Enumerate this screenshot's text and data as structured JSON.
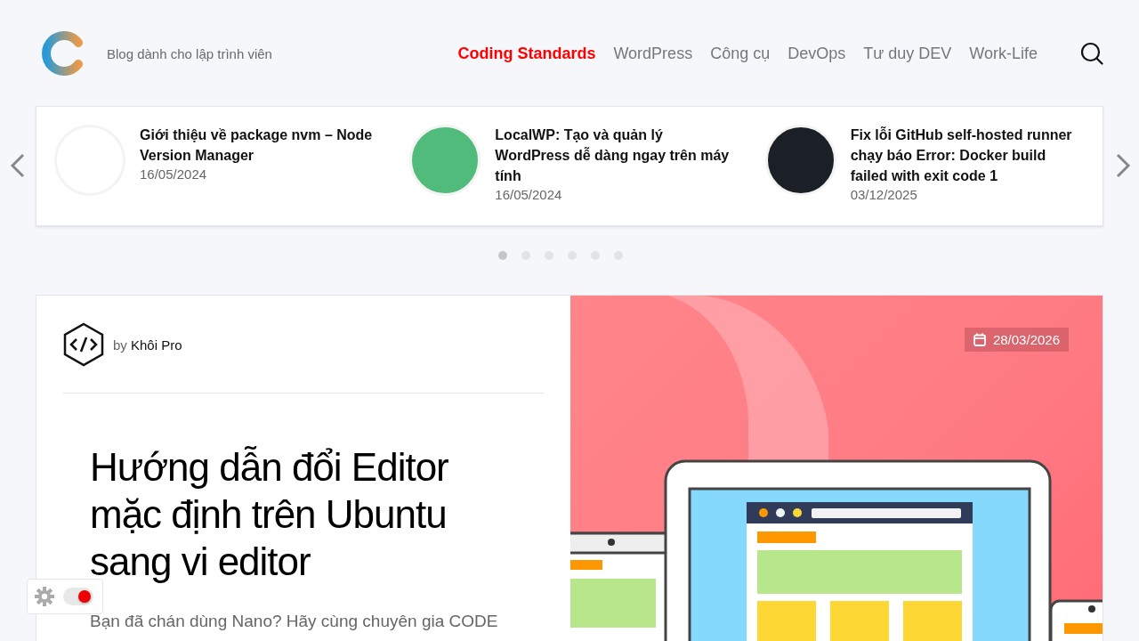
{
  "header": {
    "tagline": "Blog dành cho lập trình viên",
    "nav": [
      {
        "label": "Coding Standards",
        "selected": true
      },
      {
        "label": "WordPress",
        "selected": false
      },
      {
        "label": "Công cụ",
        "selected": false
      },
      {
        "label": "DevOps",
        "selected": false
      },
      {
        "label": "Tư duy DEV",
        "selected": false
      },
      {
        "label": "Work-Life",
        "selected": false
      }
    ]
  },
  "slider": {
    "posts": [
      {
        "title": "Giới thiệu về package nvm – Node Version Manager",
        "date": "16/05/2024",
        "color": "#ffffff"
      },
      {
        "title": "LocalWP: Tạo và quản lý WordPress dễ dàng ngay trên máy tính",
        "date": "16/05/2024",
        "color": "#51bb7b"
      },
      {
        "title": "Fix lỗi GitHub self-hosted runner chạy báo Error: Docker build failed with exit code 1",
        "date": "03/12/2025",
        "color": "#1b1f26"
      }
    ],
    "dots": [
      {
        "selected": true
      },
      {
        "selected": false
      },
      {
        "selected": false
      },
      {
        "selected": false
      },
      {
        "selected": false
      },
      {
        "selected": false
      }
    ]
  },
  "featured": {
    "by": "by",
    "author": "Khôi Pro",
    "title": "Hướng dẫn đổi Editor mặc định trên Ubuntu sang vi editor",
    "excerpt": "Bạn đã chán dùng Nano? Hãy cùng chuyên gia CODE",
    "date": "28/03/2026"
  },
  "theme_toggle": {
    "on": true
  }
}
